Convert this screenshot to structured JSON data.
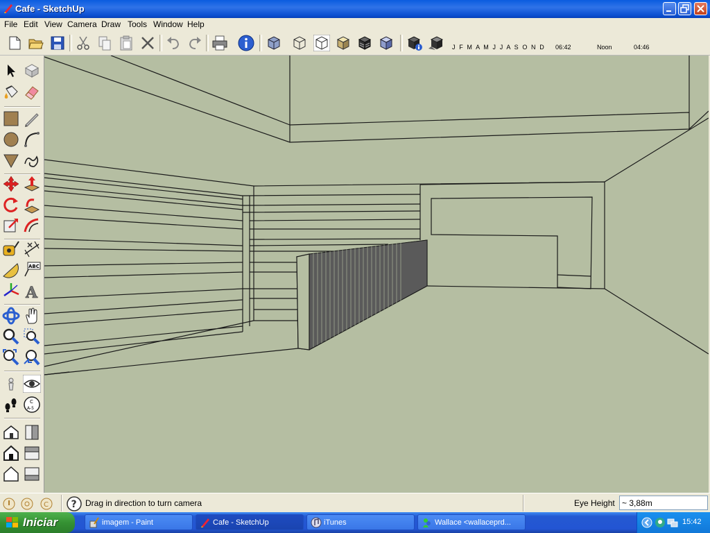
{
  "window": {
    "title": "Cafe - SketchUp"
  },
  "menu": [
    "File",
    "Edit",
    "View",
    "Camera",
    "Draw",
    "Tools",
    "Window",
    "Help"
  ],
  "toolbar": {
    "shadow_months": "J F M A M J J A S O N D",
    "time_start": "06:42",
    "time_mid": "Noon",
    "time_end": "04:46"
  },
  "status": {
    "hint": "Drag in direction to turn camera",
    "vcb_label": "Eye Height",
    "vcb_value": "~ 3,88m"
  },
  "taskbar": {
    "start_label": "Iniciar",
    "tasks": [
      {
        "label": "imagem - Paint"
      },
      {
        "label": "Cafe - SketchUp"
      },
      {
        "label": "iTunes"
      },
      {
        "label": "Wallace <wallaceprd..."
      }
    ],
    "clock": "15:42"
  },
  "colors": {
    "viewport": "#b5bea2",
    "chrome": "#ece9d8",
    "title_blue": "#0a5cdf"
  }
}
